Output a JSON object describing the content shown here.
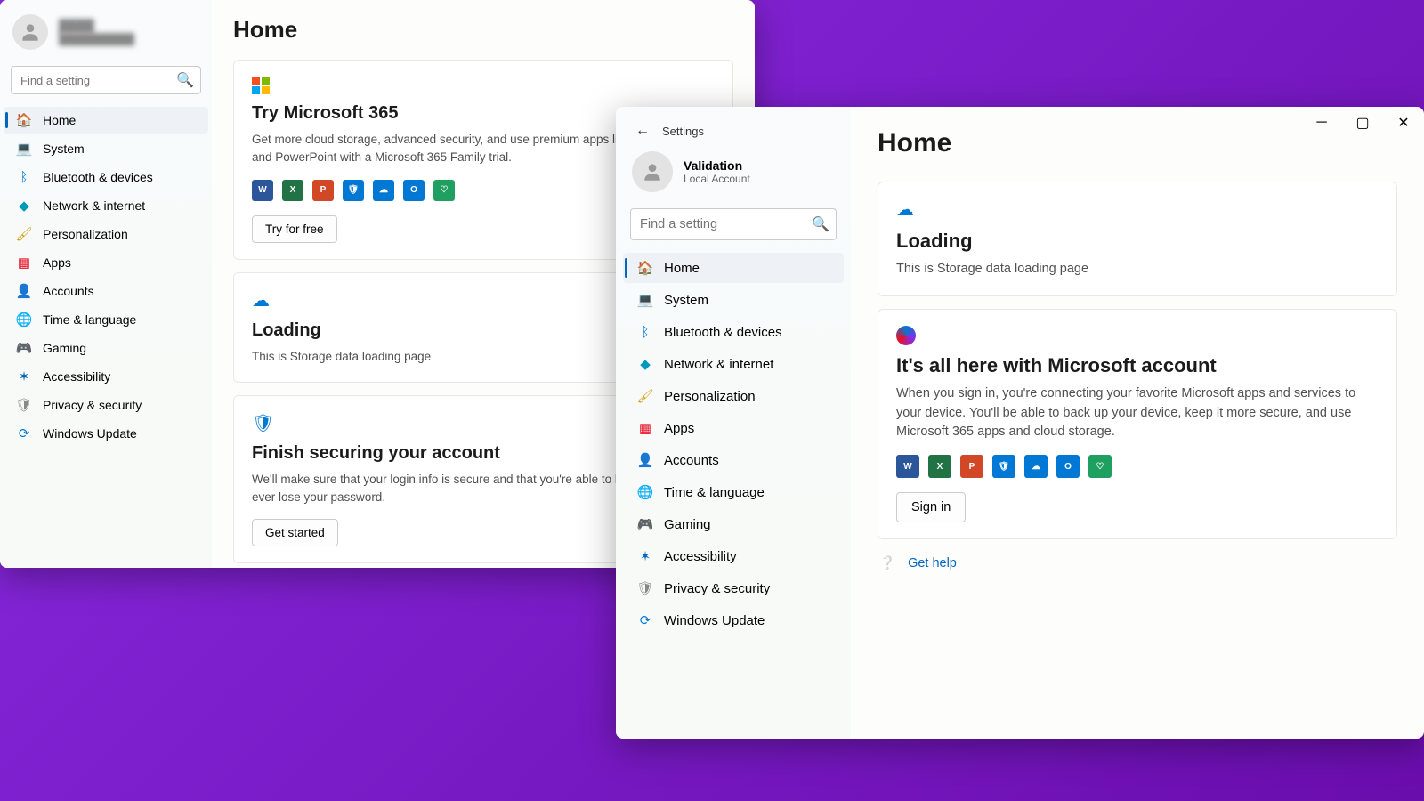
{
  "left": {
    "account": {
      "name": "████",
      "sub": "██████████"
    },
    "search_placeholder": "Find a setting",
    "nav": [
      {
        "id": "home",
        "label": "Home",
        "active": true,
        "icon": "🏠",
        "cls": "i-home"
      },
      {
        "id": "system",
        "label": "System",
        "active": false,
        "icon": "💻",
        "cls": "i-sys"
      },
      {
        "id": "bluetooth-devices",
        "label": "Bluetooth & devices",
        "active": false,
        "icon": "ᛒ",
        "cls": "i-bt"
      },
      {
        "id": "network-internet",
        "label": "Network & internet",
        "active": false,
        "icon": "◆",
        "cls": "i-net"
      },
      {
        "id": "personalization",
        "label": "Personalization",
        "active": false,
        "icon": "🖌",
        "cls": "i-pers"
      },
      {
        "id": "apps",
        "label": "Apps",
        "active": false,
        "icon": "▦",
        "cls": "i-apps"
      },
      {
        "id": "accounts",
        "label": "Accounts",
        "active": false,
        "icon": "👤",
        "cls": "i-acc"
      },
      {
        "id": "time-language",
        "label": "Time & language",
        "active": false,
        "icon": "🌐",
        "cls": "i-time"
      },
      {
        "id": "gaming",
        "label": "Gaming",
        "active": false,
        "icon": "🎮",
        "cls": "i-game"
      },
      {
        "id": "accessibility",
        "label": "Accessibility",
        "active": false,
        "icon": "✶",
        "cls": "i-acce"
      },
      {
        "id": "privacy-security",
        "label": "Privacy & security",
        "active": false,
        "icon": "🛡",
        "cls": "i-priv"
      },
      {
        "id": "windows-update",
        "label": "Windows Update",
        "active": false,
        "icon": "⟳",
        "cls": "i-upd"
      }
    ],
    "page_title": "Home",
    "cards": {
      "m365": {
        "title": "Try Microsoft 365",
        "body": "Get more cloud storage, advanced security, and use premium apps like Word, Excel, and PowerPoint with a Microsoft 365 Family trial.",
        "button": "Try for free"
      },
      "loading": {
        "title": "Loading",
        "body": "This is Storage data loading page"
      },
      "secure": {
        "title": "Finish securing your account",
        "body": "We'll make sure that your login info is secure and that you're able to log back in if you ever lose your password.",
        "button": "Get started"
      }
    }
  },
  "right": {
    "titlebar_app": "Settings",
    "account": {
      "name": "Validation",
      "sub": "Local Account"
    },
    "search_placeholder": "Find a setting",
    "nav": [
      {
        "id": "home",
        "label": "Home",
        "active": true,
        "icon": "🏠",
        "cls": "i-home"
      },
      {
        "id": "system",
        "label": "System",
        "active": false,
        "icon": "💻",
        "cls": "i-sys"
      },
      {
        "id": "bluetooth-devices",
        "label": "Bluetooth & devices",
        "active": false,
        "icon": "ᛒ",
        "cls": "i-bt"
      },
      {
        "id": "network-internet",
        "label": "Network & internet",
        "active": false,
        "icon": "◆",
        "cls": "i-net"
      },
      {
        "id": "personalization",
        "label": "Personalization",
        "active": false,
        "icon": "🖌",
        "cls": "i-pers"
      },
      {
        "id": "apps",
        "label": "Apps",
        "active": false,
        "icon": "▦",
        "cls": "i-apps"
      },
      {
        "id": "accounts",
        "label": "Accounts",
        "active": false,
        "icon": "👤",
        "cls": "i-acc"
      },
      {
        "id": "time-language",
        "label": "Time & language",
        "active": false,
        "icon": "🌐",
        "cls": "i-time"
      },
      {
        "id": "gaming",
        "label": "Gaming",
        "active": false,
        "icon": "🎮",
        "cls": "i-game"
      },
      {
        "id": "accessibility",
        "label": "Accessibility",
        "active": false,
        "icon": "✶",
        "cls": "i-acce"
      },
      {
        "id": "privacy-security",
        "label": "Privacy & security",
        "active": false,
        "icon": "🛡",
        "cls": "i-priv"
      },
      {
        "id": "windows-update",
        "label": "Windows Update",
        "active": false,
        "icon": "⟳",
        "cls": "i-upd"
      }
    ],
    "page_title": "Home",
    "cards": {
      "loading": {
        "title": "Loading",
        "body": "This is Storage data loading page"
      },
      "msacct": {
        "title": "It's all here with Microsoft account",
        "body": "When you sign in, you're connecting your favorite Microsoft apps and services to your device. You'll be able to back up your device, keep it more secure, and use Microsoft 365 apps and cloud storage.",
        "button": "Sign in"
      }
    },
    "help_link": "Get help"
  },
  "app_icons": [
    {
      "id": "word",
      "color": "#2b579a",
      "glyph": "W"
    },
    {
      "id": "excel",
      "color": "#217346",
      "glyph": "X"
    },
    {
      "id": "powerpoint",
      "color": "#d24726",
      "glyph": "P"
    },
    {
      "id": "defender",
      "color": "#0078d4",
      "glyph": "🛡"
    },
    {
      "id": "onedrive",
      "color": "#0078d4",
      "glyph": "☁"
    },
    {
      "id": "outlook",
      "color": "#0078d4",
      "glyph": "O"
    },
    {
      "id": "family",
      "color": "#20a060",
      "glyph": "♡"
    }
  ]
}
